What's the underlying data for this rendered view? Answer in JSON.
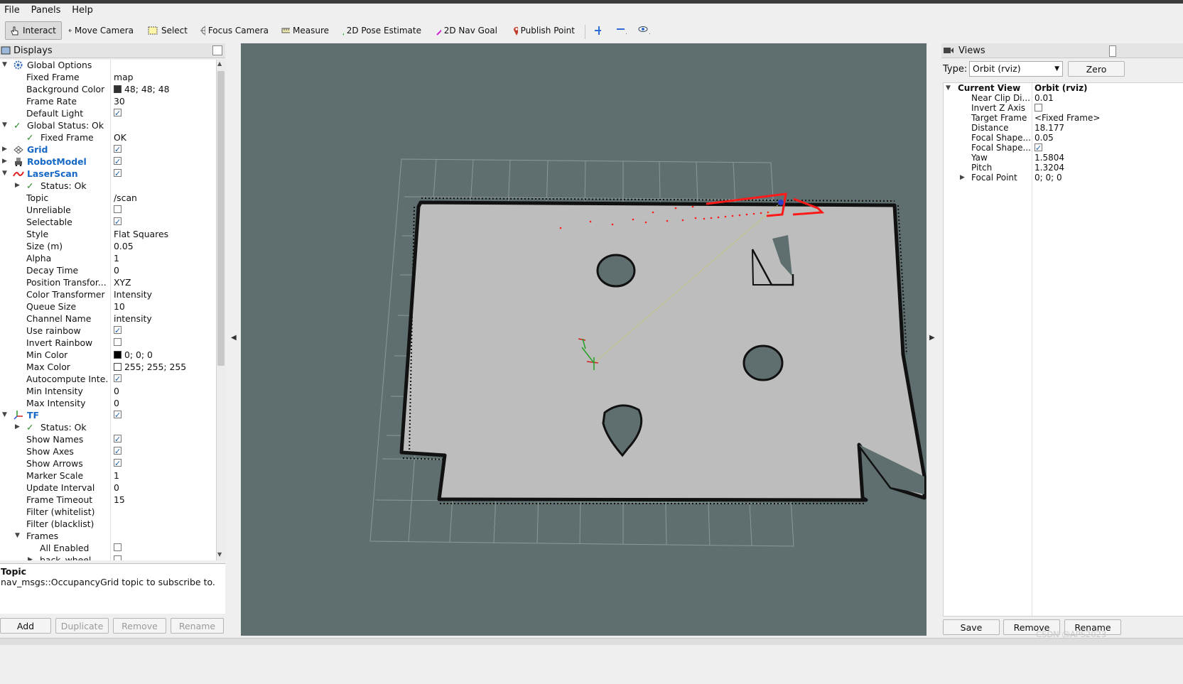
{
  "menu": [
    "File",
    "Panels",
    "Help"
  ],
  "toolbar": {
    "interact": "Interact",
    "move_camera": "Move Camera",
    "select": "Select",
    "focus_camera": "Focus Camera",
    "measure": "Measure",
    "pose_estimate": "2D Pose Estimate",
    "nav_goal": "2D Nav Goal",
    "publish_point": "Publish Point"
  },
  "displays": {
    "title": "Displays",
    "rows": [
      {
        "label": "Global Options",
        "value": ""
      },
      {
        "label": "Fixed Frame",
        "value": "map"
      },
      {
        "label": "Background Color",
        "value": "48; 48; 48"
      },
      {
        "label": "Frame Rate",
        "value": "30"
      },
      {
        "label": "Default Light",
        "value": ""
      },
      {
        "label": "Global Status: Ok",
        "value": ""
      },
      {
        "label": "Fixed Frame",
        "value": "OK"
      },
      {
        "label": "Grid",
        "value": ""
      },
      {
        "label": "RobotModel",
        "value": ""
      },
      {
        "label": "LaserScan",
        "value": ""
      },
      {
        "label": "Status: Ok",
        "value": ""
      },
      {
        "label": "Topic",
        "value": "/scan"
      },
      {
        "label": "Unreliable",
        "value": ""
      },
      {
        "label": "Selectable",
        "value": ""
      },
      {
        "label": "Style",
        "value": "Flat Squares"
      },
      {
        "label": "Size (m)",
        "value": "0.05"
      },
      {
        "label": "Alpha",
        "value": "1"
      },
      {
        "label": "Decay Time",
        "value": "0"
      },
      {
        "label": "Position Transfor...",
        "value": "XYZ"
      },
      {
        "label": "Color Transformer",
        "value": "Intensity"
      },
      {
        "label": "Queue Size",
        "value": "10"
      },
      {
        "label": "Channel Name",
        "value": "intensity"
      },
      {
        "label": "Use rainbow",
        "value": ""
      },
      {
        "label": "Invert Rainbow",
        "value": ""
      },
      {
        "label": "Min Color",
        "value": "0; 0; 0"
      },
      {
        "label": "Max Color",
        "value": "255; 255; 255"
      },
      {
        "label": "Autocompute Inte...",
        "value": ""
      },
      {
        "label": "Min Intensity",
        "value": "0"
      },
      {
        "label": "Max Intensity",
        "value": "0"
      },
      {
        "label": "TF",
        "value": ""
      },
      {
        "label": "Status: Ok",
        "value": ""
      },
      {
        "label": "Show Names",
        "value": ""
      },
      {
        "label": "Show Axes",
        "value": ""
      },
      {
        "label": "Show Arrows",
        "value": ""
      },
      {
        "label": "Marker Scale",
        "value": "1"
      },
      {
        "label": "Update Interval",
        "value": "0"
      },
      {
        "label": "Frame Timeout",
        "value": "15"
      },
      {
        "label": "Filter (whitelist)",
        "value": ""
      },
      {
        "label": "Filter (blacklist)",
        "value": ""
      },
      {
        "label": "Frames",
        "value": ""
      },
      {
        "label": "All Enabled",
        "value": ""
      },
      {
        "label": "back_wheel",
        "value": ""
      }
    ],
    "desc_title": "Topic",
    "desc_text": "nav_msgs::OccupancyGrid topic to subscribe to.",
    "buttons": {
      "add": "Add",
      "duplicate": "Duplicate",
      "remove": "Remove",
      "rename": "Rename"
    }
  },
  "views": {
    "title": "Views",
    "type_label": "Type:",
    "type_value": "Orbit (rviz)",
    "zero": "Zero",
    "rows": [
      {
        "label": "Current View",
        "value": "Orbit (rviz)"
      },
      {
        "label": "Near Clip Di...",
        "value": "0.01"
      },
      {
        "label": "Invert Z Axis",
        "value": ""
      },
      {
        "label": "Target Frame",
        "value": "<Fixed Frame>"
      },
      {
        "label": "Distance",
        "value": "18.177"
      },
      {
        "label": "Focal Shape...",
        "value": "0.05"
      },
      {
        "label": "Focal Shape...",
        "value": ""
      },
      {
        "label": "Yaw",
        "value": "1.5804"
      },
      {
        "label": "Pitch",
        "value": "1.3204"
      },
      {
        "label": "Focal Point",
        "value": "0; 0; 0"
      }
    ],
    "buttons": {
      "save": "Save",
      "remove": "Remove",
      "rename": "Rename"
    }
  },
  "watermark": "CSDN @APS2023",
  "colors": {
    "viewport_bg": "#5f6f6f",
    "map_free": "#bdbdbd",
    "laser": "#ff1a1a",
    "accent": "#1668c6"
  }
}
